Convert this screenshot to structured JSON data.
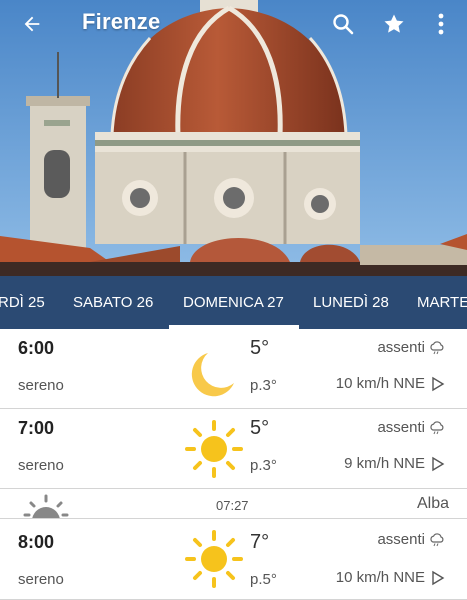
{
  "header": {
    "title": "Firenze",
    "icons": [
      "back-arrow-icon",
      "search-icon",
      "star-icon",
      "more-vert-icon"
    ]
  },
  "tabs": [
    {
      "label": "RDÌ 25",
      "active": false
    },
    {
      "label": "SABATO 26",
      "active": false
    },
    {
      "label": "DOMENICA 27",
      "active": true
    },
    {
      "label": "LUNEDÌ 28",
      "active": false
    },
    {
      "label": "MARTE",
      "active": false
    }
  ],
  "hours": [
    {
      "time": "6:00",
      "condition": "sereno",
      "icon": "moon-icon",
      "temp": "5°",
      "prob": "p.3°",
      "precip": "assenti",
      "wind": "10 km/h NNE"
    },
    {
      "time": "7:00",
      "condition": "sereno",
      "icon": "sun-icon",
      "temp": "5°",
      "prob": "p.3°",
      "precip": "assenti",
      "wind": "9 km/h NNE"
    },
    {
      "time": "8:00",
      "condition": "sereno",
      "icon": "sun-icon",
      "temp": "7°",
      "prob": "p.5°",
      "precip": "assenti",
      "wind": "10 km/h NNE"
    }
  ],
  "sunrise": {
    "time": "07:27",
    "label": "Alba",
    "icon": "sunrise-icon"
  },
  "colors": {
    "tab_bar": "#2b4a73",
    "sun": "#f6c31c",
    "moon": "#f8c94a",
    "text": "#555555"
  }
}
